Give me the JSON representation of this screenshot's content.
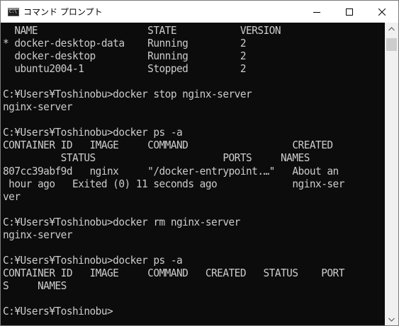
{
  "window": {
    "title": "コマンド プロンプト"
  },
  "console": {
    "lines": [
      "  NAME                   STATE           VERSION",
      "* docker-desktop-data    Running         2",
      "  docker-desktop         Running         2",
      "  ubuntu2004-1           Stopped         2",
      "",
      "C:¥Users¥Toshinobu>docker stop nginx-server",
      "nginx-server",
      "",
      "C:¥Users¥Toshinobu>docker ps -a",
      "CONTAINER ID   IMAGE     COMMAND                  CREATED",
      "          STATUS                      PORTS     NAMES",
      "807cc39abf9d   nginx     \"/docker-entrypoint.…\"   About an",
      " hour ago   Exited (0) 11 seconds ago             nginx-ser",
      "ver",
      "",
      "C:¥Users¥Toshinobu>docker rm nginx-server",
      "nginx-server",
      "",
      "C:¥Users¥Toshinobu>docker ps -a",
      "CONTAINER ID   IMAGE     COMMAND   CREATED   STATUS    PORT",
      "S     NAMES",
      "",
      "C:¥Users¥Toshinobu>"
    ]
  },
  "icons": {
    "app": "console-app-icon",
    "minimize": "minimize-icon",
    "maximize": "maximize-icon",
    "close": "close-icon",
    "scroll_up": "scroll-up-arrow-icon",
    "scroll_down": "scroll-down-arrow-icon"
  },
  "colors": {
    "console_background": "#0c0c0c",
    "console_text": "#cccccc",
    "titlebar_background": "#ffffff",
    "scrollbar_track": "#f0f0f0",
    "scrollbar_thumb": "#cdcdcd"
  }
}
